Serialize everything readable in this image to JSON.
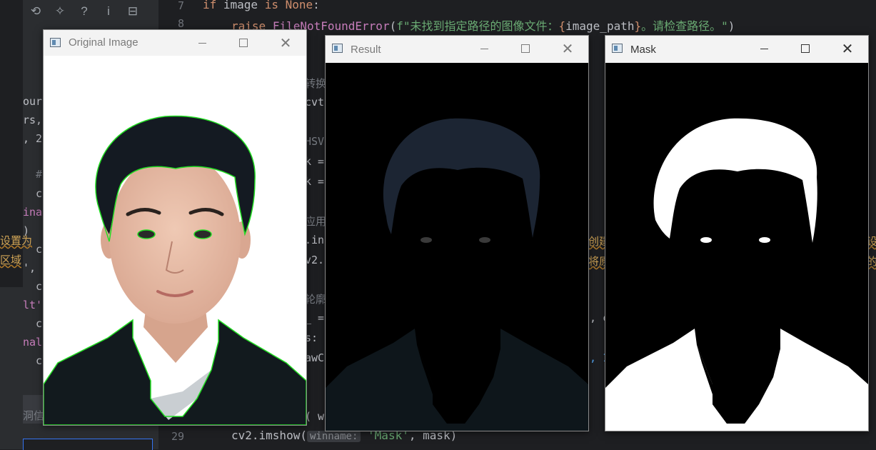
{
  "toolbar_icons": [
    "history-icon",
    "magic-icon",
    "help-icon",
    "info-icon",
    "collapse-icon"
  ],
  "toolbar_glyphs": [
    "⟲",
    "✧",
    "?",
    "i",
    "⊟"
  ],
  "gutter": {
    "line7": "7",
    "line8": "8",
    "line29": "29"
  },
  "code": {
    "line7": {
      "kw_if": "if",
      "mid": " image ",
      "kw_is": "is",
      "none": "None",
      "colon": ":"
    },
    "line8": {
      "kw_raise": "raise",
      "cls": "FileNotFoundError",
      "paren": "(",
      "fstr_open": "f\"未找到指定路径的图像文件：",
      "brace_open": "{",
      "var": "image_path",
      "brace_close": "}",
      "fstr_close": "。请检查路径。\"",
      "close": ")"
    },
    "line29": {
      "fn": "cv2.imshow(",
      "hint": "winname:",
      "arg": " 'Mask'",
      "rest": ", mask)"
    }
  },
  "left_fragments": [
    {
      "text": "our",
      "style": "plain"
    },
    {
      "text": "rs,",
      "style": "plain"
    },
    {
      "text": ", 2",
      "style": "plain"
    },
    {
      "text": "#",
      "style": "grey"
    },
    {
      "text": "c",
      "style": "plain"
    },
    {
      "text": "ina",
      "style": "purple"
    },
    {
      "text": ")",
      "style": "plain"
    },
    {
      "text": "设置为",
      "style": "warn"
    },
    {
      "text": "c",
      "style": "plain"
    },
    {
      "text": "区域",
      "style": "warn"
    },
    {
      "text": "',",
      "style": "plain"
    },
    {
      "text": "c",
      "style": "plain"
    },
    {
      "text": "lt'",
      "style": "purple"
    },
    {
      "text": "c",
      "style": "plain"
    },
    {
      "text": "nal",
      "style": "purple"
    },
    {
      "text": "c",
      "style": "plain"
    },
    {
      "text": "洞信息",
      "style": "grey"
    }
  ],
  "mid_fragments": [
    {
      "text": "转换",
      "style": "grey"
    },
    {
      "text": "cvt",
      "style": "plain"
    },
    {
      "text": "HSV",
      "style": "grey"
    },
    {
      "text": "k =",
      "style": "plain"
    },
    {
      "text": "k =",
      "style": "plain"
    },
    {
      "text": "应用",
      "style": "grey"
    },
    {
      "text": ".in",
      "style": "plain"
    },
    {
      "text": "v2.",
      "style": "plain"
    },
    {
      "text": "轮廓",
      "style": "grey"
    },
    {
      "text": "_ =",
      "style": "plain"
    },
    {
      "text": "s:",
      "style": "plain"
    },
    {
      "text": "awC",
      "style": "plain"
    },
    {
      "text": "( w",
      "style": "plain"
    }
  ],
  "right_fragments": [
    {
      "text": "创建",
      "style": "warn"
    },
    {
      "text": "将原",
      "style": "warn"
    },
    {
      "text": ", c",
      "style": "plain"
    },
    {
      "text": ", 1",
      "style": "blue"
    },
    {
      "text": "设",
      "style": "warn"
    },
    {
      "text": "的",
      "style": "warn"
    }
  ],
  "windows": {
    "original": {
      "title": "Original Image"
    },
    "result": {
      "title": "Result"
    },
    "mask": {
      "title": "Mask"
    }
  },
  "colors": {
    "contour": "#22dd22",
    "mask_white": "#ffffff",
    "ide_bg": "#1e1f22"
  }
}
